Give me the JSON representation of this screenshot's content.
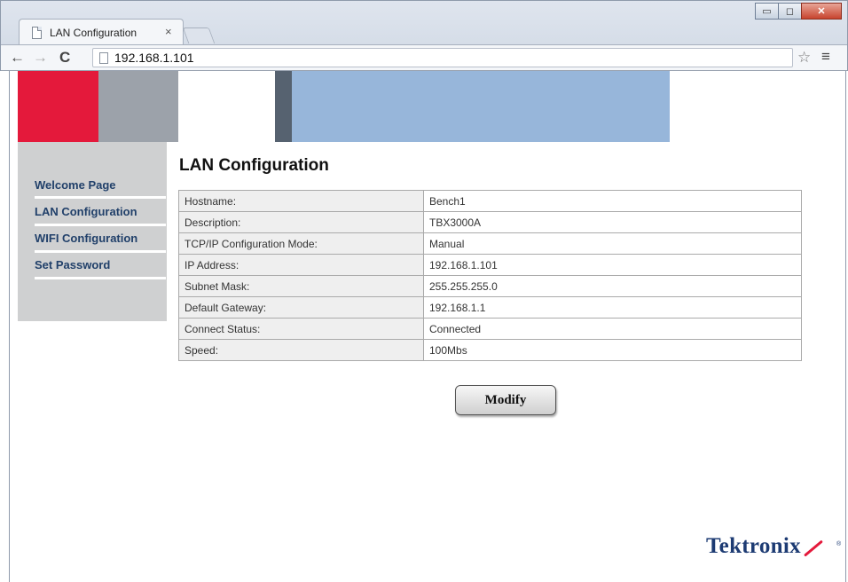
{
  "browser": {
    "tab_title": "LAN Configuration",
    "tab_close": "×",
    "url": "192.168.1.101",
    "back_icon": "←",
    "forward_icon": "→",
    "reload_icon": "C",
    "star_icon": "☆",
    "menu_icon": "≡",
    "minimize_icon": "▭",
    "maximize_icon": "◻",
    "close_icon": "✕"
  },
  "colors": {
    "banner_red": "#e4193b",
    "banner_gray": "#9ca2aa",
    "banner_dark": "#566270",
    "banner_blue": "#97b6da",
    "nav_text": "#21406a",
    "logo": "#1d3b73"
  },
  "sidebar": {
    "items": [
      {
        "label": "Welcome Page"
      },
      {
        "label": "LAN Configuration"
      },
      {
        "label": "WIFI Configuration"
      },
      {
        "label": "Set Password"
      }
    ]
  },
  "main": {
    "title": "LAN Configuration",
    "rows": [
      {
        "label": "Hostname:",
        "value": "Bench1"
      },
      {
        "label": "Description:",
        "value": "TBX3000A"
      },
      {
        "label": "TCP/IP Configuration Mode:",
        "value": "Manual"
      },
      {
        "label": "IP Address:",
        "value": "192.168.1.101"
      },
      {
        "label": "Subnet Mask:",
        "value": "255.255.255.0"
      },
      {
        "label": "Default Gateway:",
        "value": "192.168.1.1"
      },
      {
        "label": "Connect Status:",
        "value": "Connected"
      },
      {
        "label": "Speed:",
        "value": "100Mbs"
      }
    ],
    "modify_label": "Modify"
  },
  "footer": {
    "logo_text": "Tektronix",
    "logo_mark": "®"
  }
}
